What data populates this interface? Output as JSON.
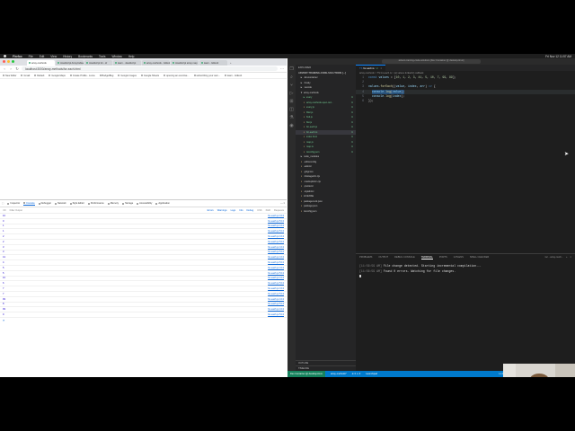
{
  "menubar": {
    "app": "Firefox",
    "items": [
      "File",
      "Edit",
      "View",
      "History",
      "Bookmarks",
      "Tools",
      "Window",
      "Help"
    ],
    "clock": "Fri Nov 12  11:57 AM"
  },
  "browser": {
    "tabs": [
      {
        "label": "array-methods"
      },
      {
        "label": "JavaScript Array.forEach"
      },
      {
        "label": "JavaScript for...of"
      },
      {
        "label": "learn - JavaScript"
      },
      {
        "label": "array-methods - GitHub"
      },
      {
        "label": "JavaScript array map"
      },
      {
        "label": "learn - GitHub"
      }
    ],
    "url": "localhost:3000/array-methods/for-each.html",
    "bookmarks": [
      "New folder",
      "Gmail",
      "Default",
      "Google Maps",
      "Create Profile - Luma",
      "BudgetBug",
      "Google Images",
      "Google Sheets",
      "opening an exercise...",
      "subscribing your own...",
      "learn - GitHub"
    ],
    "devtools": {
      "tabs": [
        "Inspector",
        "Console",
        "Debugger",
        "Network",
        "Style Editor",
        "Performance",
        "Memory",
        "Storage",
        "Accessibility",
        "Application"
      ],
      "filter_placeholder": "Filter Output",
      "levels": [
        "Errors",
        "Warnings",
        "Logs",
        "Info",
        "Debug"
      ],
      "right_labels": [
        "CSS",
        "XHR",
        "Requests"
      ],
      "log": [
        {
          "value": "10",
          "source": "for-each.js:4:13"
        },
        {
          "value": "0",
          "source": "for-each.js:5:13"
        },
        {
          "value": "1",
          "source": "for-each.js:4:13"
        },
        {
          "value": "1",
          "source": "for-each.js:5:13"
        },
        {
          "value": "2",
          "source": "for-each.js:4:13"
        },
        {
          "value": "2",
          "source": "for-each.js:5:13"
        },
        {
          "value": "3",
          "source": "for-each.js:4:13"
        },
        {
          "value": "3",
          "source": "for-each.js:5:13"
        },
        {
          "value": "41",
          "source": "for-each.js:4:13"
        },
        {
          "value": "4",
          "source": "for-each.js:5:13"
        },
        {
          "value": "5",
          "source": "for-each.js:4:13"
        },
        {
          "value": "5",
          "source": "for-each.js:5:13"
        },
        {
          "value": "10",
          "source": "for-each.js:4:13"
        },
        {
          "value": "6",
          "source": "for-each.js:5:13"
        },
        {
          "value": "7",
          "source": "for-each.js:4:13"
        },
        {
          "value": "7",
          "source": "for-each.js:5:13"
        },
        {
          "value": "99",
          "source": "for-each.js:4:13"
        },
        {
          "value": "8",
          "source": "for-each.js:5:13"
        },
        {
          "value": "99",
          "source": "for-each.js:4:13"
        },
        {
          "value": "9",
          "source": "for-each.js:5:13"
        }
      ],
      "prompt": "»"
    }
  },
  "vscode": {
    "search": "advent-training-code-solutions [Dev Container @ desktop-linux]",
    "explorer": {
      "header": "EXPLORER",
      "root": "ADVENT-TRAINING-CODE-SOLUTIONS [...]",
      "items": [
        {
          "label": ".devcontainer",
          "kind": "folder",
          "indent": 1
        },
        {
          "label": ".husky",
          "kind": "folder",
          "indent": 1
        },
        {
          "label": ".vscode",
          "kind": "folder",
          "indent": 1
        },
        {
          "label": "array-methods",
          "kind": "folder-open",
          "indent": 1
        },
        {
          "label": "every",
          "kind": "folder",
          "indent": 2,
          "badge": "U"
        },
        {
          "label": "array-methods-spec-red...",
          "kind": "file",
          "indent": 2,
          "badge": "U"
        },
        {
          "label": "every.js",
          "kind": "file",
          "indent": 2,
          "badge": "U"
        },
        {
          "label": "filter.js",
          "kind": "file",
          "indent": 2,
          "badge": "U"
        },
        {
          "label": "find.js",
          "kind": "file",
          "indent": 2,
          "badge": "U"
        },
        {
          "label": "flat.js",
          "kind": "file",
          "indent": 2,
          "badge": "U"
        },
        {
          "label": "for-each.js",
          "kind": "file",
          "indent": 2,
          "badge": "U"
        },
        {
          "label": "for-each.ts",
          "kind": "file",
          "indent": 2,
          "badge": "U",
          "selected": true
        },
        {
          "label": "index.html",
          "kind": "file",
          "indent": 2,
          "badge": "U"
        },
        {
          "label": "map.js",
          "kind": "file",
          "indent": 2,
          "badge": "U"
        },
        {
          "label": "map.ts",
          "kind": "file",
          "indent": 2,
          "badge": "U"
        },
        {
          "label": "tsconfig.json",
          "kind": "file",
          "indent": 2,
          "badge": "U"
        },
        {
          "label": "node_modules",
          "kind": "folder",
          "indent": 1
        },
        {
          "label": ".editorconfig",
          "kind": "file",
          "indent": 1
        },
        {
          "label": ".eslintrc",
          "kind": "file",
          "indent": 1
        },
        {
          "label": ".gitignore",
          "kind": "file",
          "indent": 1
        },
        {
          "label": ".lintstagedrc.cjs",
          "kind": "file",
          "indent": 1
        },
        {
          "label": ".markuplintrc.cjs",
          "kind": "file",
          "indent": 1
        },
        {
          "label": ".prettierrc",
          "kind": "file",
          "indent": 1
        },
        {
          "label": ".stylelintrc",
          "kind": "file",
          "indent": 1
        },
        {
          "label": "LICENSE",
          "kind": "file",
          "indent": 1
        },
        {
          "label": "package-lock.json",
          "kind": "file",
          "indent": 1
        },
        {
          "label": "package.json",
          "kind": "file",
          "indent": 1
        },
        {
          "label": "tsconfig.json",
          "kind": "file",
          "indent": 1
        }
      ],
      "outline": "OUTLINE",
      "timeline": "TIMELINE"
    },
    "editor": {
      "tab": "for-each.ts",
      "tab_badge": "U",
      "breadcrumb": "array-methods > TS for-each.ts > [e] values.forEach() callback",
      "lines": [
        {
          "n": "1",
          "parts": [
            {
              "c": "kw",
              "t": "const "
            },
            {
              "c": "var",
              "t": "values"
            },
            {
              "c": "pl",
              "t": " = ["
            },
            {
              "c": "num",
              "t": "10"
            },
            {
              "c": "pl",
              "t": ", "
            },
            {
              "c": "num",
              "t": "1"
            },
            {
              "c": "pl",
              "t": ", "
            },
            {
              "c": "num",
              "t": "2"
            },
            {
              "c": "pl",
              "t": ", "
            },
            {
              "c": "num",
              "t": "3"
            },
            {
              "c": "pl",
              "t": ", "
            },
            {
              "c": "num",
              "t": "41"
            },
            {
              "c": "pl",
              "t": ", "
            },
            {
              "c": "num",
              "t": "5"
            },
            {
              "c": "pl",
              "t": ", "
            },
            {
              "c": "num",
              "t": "10"
            },
            {
              "c": "pl",
              "t": ", "
            },
            {
              "c": "num",
              "t": "7"
            },
            {
              "c": "pl",
              "t": ", "
            },
            {
              "c": "num",
              "t": "99"
            },
            {
              "c": "pl",
              "t": ", "
            },
            {
              "c": "num",
              "t": "99"
            },
            {
              "c": "pl",
              "t": "];"
            }
          ]
        },
        {
          "n": "2",
          "parts": []
        },
        {
          "n": "3",
          "parts": [
            {
              "c": "var",
              "t": "values"
            },
            {
              "c": "pl",
              "t": "."
            },
            {
              "c": "fn",
              "t": "forEach"
            },
            {
              "c": "pl",
              "t": "(("
            },
            {
              "c": "var",
              "t": "value"
            },
            {
              "c": "pl",
              "t": ", "
            },
            {
              "c": "var",
              "t": "index"
            },
            {
              "c": "pl",
              "t": ", "
            },
            {
              "c": "var",
              "t": "arr"
            },
            {
              "c": "pl",
              "t": ") "
            },
            {
              "c": "kw",
              "t": "=>"
            },
            {
              "c": "pl",
              "t": " {"
            }
          ]
        },
        {
          "n": "4",
          "cur": true,
          "parts": [
            {
              "c": "pl",
              "t": "  "
            },
            {
              "c": "var sel-hi",
              "t": "console"
            },
            {
              "c": "pl sel-hi",
              "t": "."
            },
            {
              "c": "fn sel-hi",
              "t": "log"
            },
            {
              "c": "pl sel-hi",
              "t": "("
            },
            {
              "c": "var sel-hi",
              "t": "value"
            },
            {
              "c": "pl sel-hi",
              "t": ");"
            }
          ]
        },
        {
          "n": "5",
          "parts": [
            {
              "c": "pl",
              "t": "  "
            },
            {
              "c": "var",
              "t": "console"
            },
            {
              "c": "pl",
              "t": "."
            },
            {
              "c": "fn",
              "t": "log"
            },
            {
              "c": "pl",
              "t": "("
            },
            {
              "c": "var",
              "t": "index"
            },
            {
              "c": "pl",
              "t": ");"
            }
          ]
        },
        {
          "n": "6",
          "parts": [
            {
              "c": "pl",
              "t": "});"
            }
          ]
        }
      ]
    },
    "panel": {
      "tabs": [
        "PROBLEMS",
        "OUTPUT",
        "DEBUG CONSOLE",
        "TERMINAL",
        "PORTS",
        "GITLENS",
        "SPELL CHECKER"
      ],
      "active": "TERMINAL",
      "terminal_name": "tsc - array-meth...",
      "terminal": [
        {
          "time": "[11:56:59 AM]",
          "text": " File change detected. Starting incremental compilation..."
        },
        {
          "time": "",
          "text": ""
        },
        {
          "time": "[11:56:59 AM]",
          "text": " Found 0 errors. Watching for file changes."
        }
      ]
    },
    "status": {
      "remote": "Dev Container @ desktop-linux",
      "items": [
        "array-methods*",
        "⊗ 0 ⚠ 0",
        "Launchpad"
      ],
      "right": [
        "Ln 4, Col 21",
        "Spaces: 2",
        "UTF-8",
        "LF",
        "TypeScript",
        "Prettier"
      ]
    }
  }
}
